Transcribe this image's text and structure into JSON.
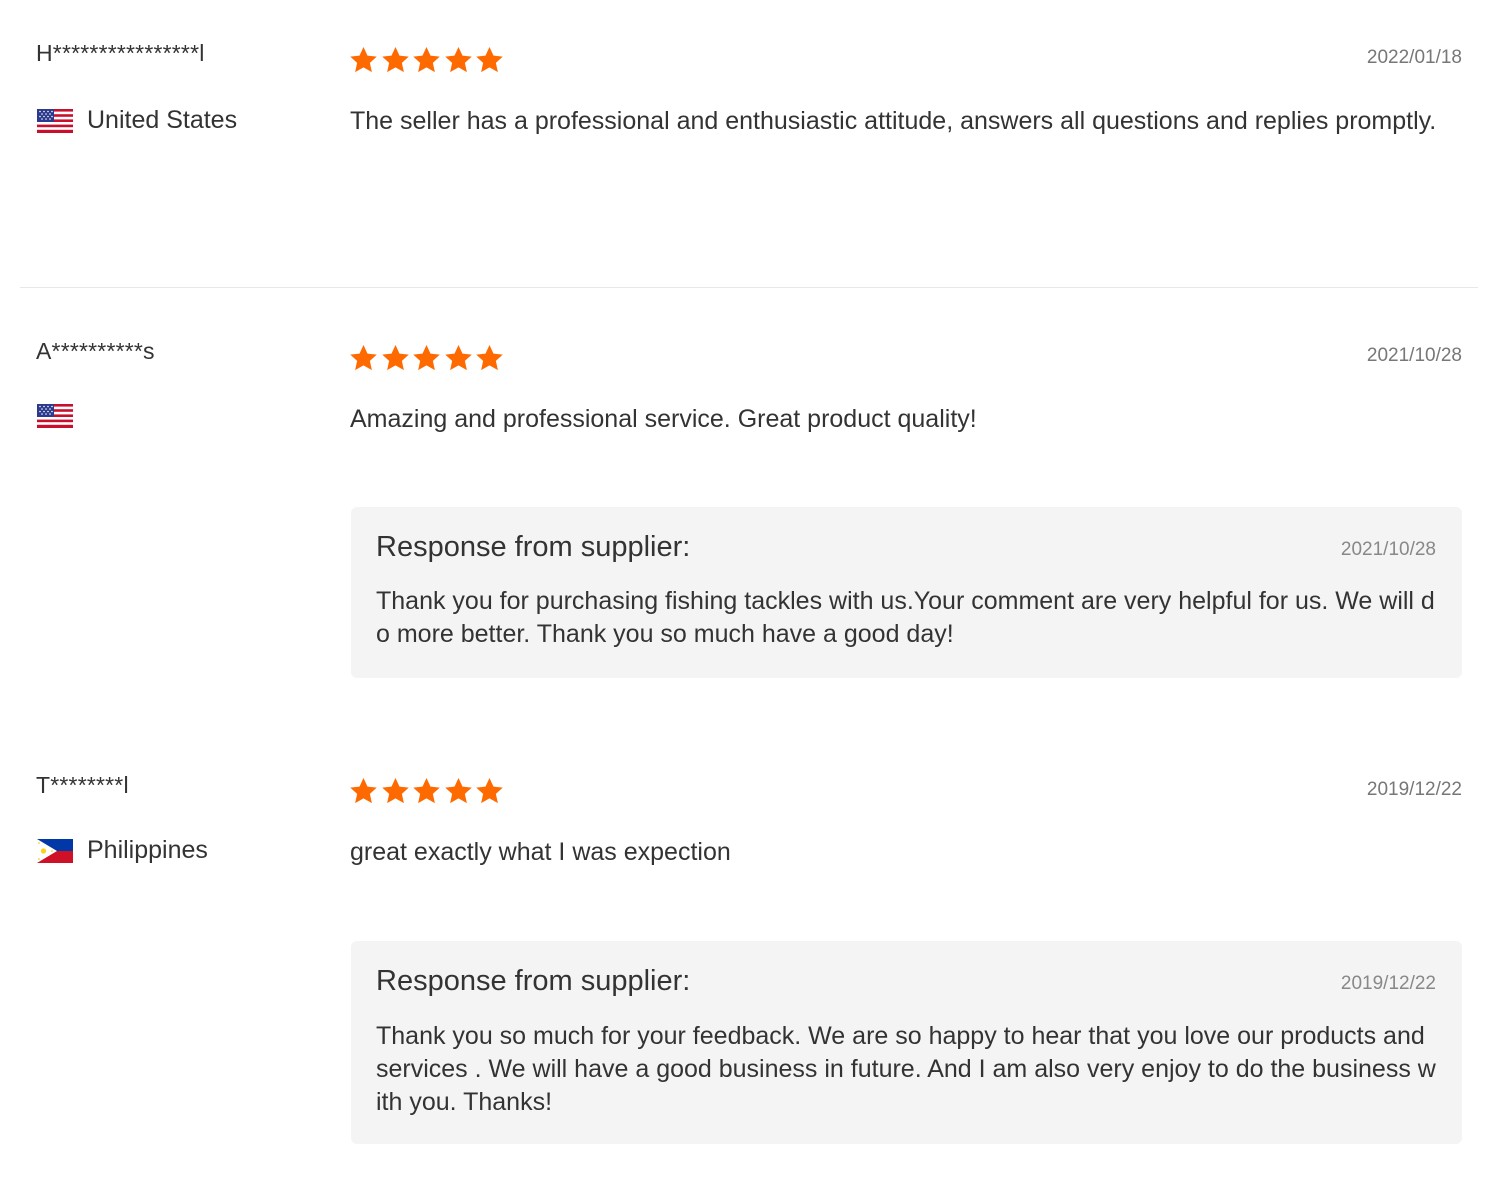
{
  "colors": {
    "star": "#ff6a00",
    "response_bg": "#f4f4f4",
    "date": "#777777"
  },
  "reviews": [
    {
      "username": "H****************l",
      "country": "United States",
      "flag": "us-flag-icon",
      "rating": 5,
      "date": "2022/01/18",
      "text": "The seller has a professional and enthusiastic attitude, answers all questions and replies promptly."
    },
    {
      "username": "A**********s",
      "country": "",
      "flag": "us-flag-icon",
      "rating": 5,
      "date": "2021/10/28",
      "text": "Amazing and professional service. Great product quality!",
      "response": {
        "title": "Response from supplier:",
        "date": "2021/10/28",
        "text": "Thank you for purchasing fishing tackles with us.Your comment are very helpful for us. We will do more better. Thank you so much have a good day!"
      }
    },
    {
      "username": "T********l",
      "country": "Philippines",
      "flag": "ph-flag-icon",
      "rating": 5,
      "date": "2019/12/22",
      "text": "great exactly what I was expection",
      "response": {
        "title": "Response from supplier:",
        "date": "2019/12/22",
        "text": "Thank you so much for your feedback. We are so happy to hear that you love our products and services . We will have a good business in future. And I am also very enjoy to do the business with you. Thanks!"
      }
    }
  ]
}
